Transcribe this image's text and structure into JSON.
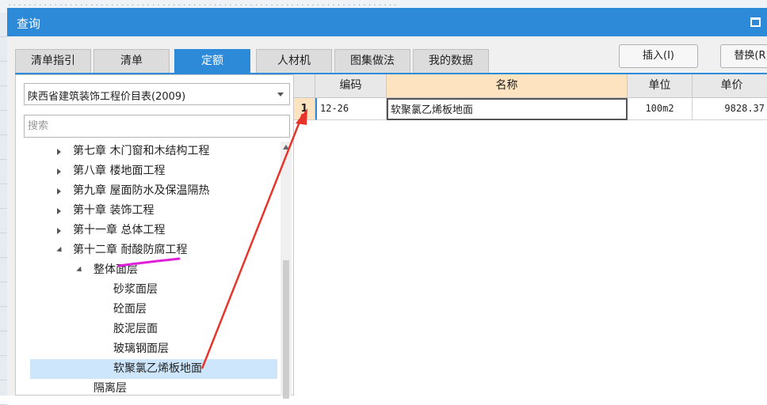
{
  "dialog": {
    "title": "查询"
  },
  "tabs": [
    {
      "label": "清单指引"
    },
    {
      "label": "清单"
    },
    {
      "label": "定额",
      "active": true
    },
    {
      "label": "人材机"
    },
    {
      "label": "图集做法"
    },
    {
      "label": "我的数据"
    }
  ],
  "buttons": {
    "insert": "插入(I)",
    "replace": "替换(R)"
  },
  "library_select": {
    "value": "陕西省建筑装饰工程价目表(2009)"
  },
  "search": {
    "placeholder": "搜索"
  },
  "tree": [
    {
      "label": "第七章 木门窗和木结构工程",
      "level": 0,
      "state": "collapsed"
    },
    {
      "label": "第八章 楼地面工程",
      "level": 0,
      "state": "collapsed"
    },
    {
      "label": "第九章 屋面防水及保温隔热",
      "level": 0,
      "state": "collapsed"
    },
    {
      "label": "第十章 装饰工程",
      "level": 0,
      "state": "collapsed"
    },
    {
      "label": "第十一章 总体工程",
      "level": 0,
      "state": "collapsed"
    },
    {
      "label": "第十二章 耐酸防腐工程",
      "level": 0,
      "state": "expanded"
    },
    {
      "label": "整体面层",
      "level": 1,
      "state": "expanded"
    },
    {
      "label": "砂浆面层",
      "level": 2,
      "state": "leaf"
    },
    {
      "label": "砼面层",
      "level": 2,
      "state": "leaf"
    },
    {
      "label": "胶泥层面",
      "level": 2,
      "state": "leaf"
    },
    {
      "label": "玻璃钢面层",
      "level": 2,
      "state": "leaf"
    },
    {
      "label": "软聚氯乙烯板地面",
      "level": 2,
      "state": "leaf",
      "selected": true
    },
    {
      "label": "隔离层",
      "level": 1,
      "state": "none"
    }
  ],
  "grid": {
    "headers": {
      "code": "编码",
      "name": "名称",
      "unit": "单位",
      "price": "单价"
    },
    "rows": [
      {
        "index": "1",
        "code": "12-26",
        "name": "软聚氯乙烯板地面",
        "unit": "100m2",
        "price": "9828.37"
      }
    ]
  },
  "colors": {
    "accent": "#2d8ad8",
    "annotation_red": "#e8352a",
    "annotation_magenta": "#e020d8",
    "selected_row": "#cde6fb",
    "header_highlight": "#fde3c0"
  }
}
